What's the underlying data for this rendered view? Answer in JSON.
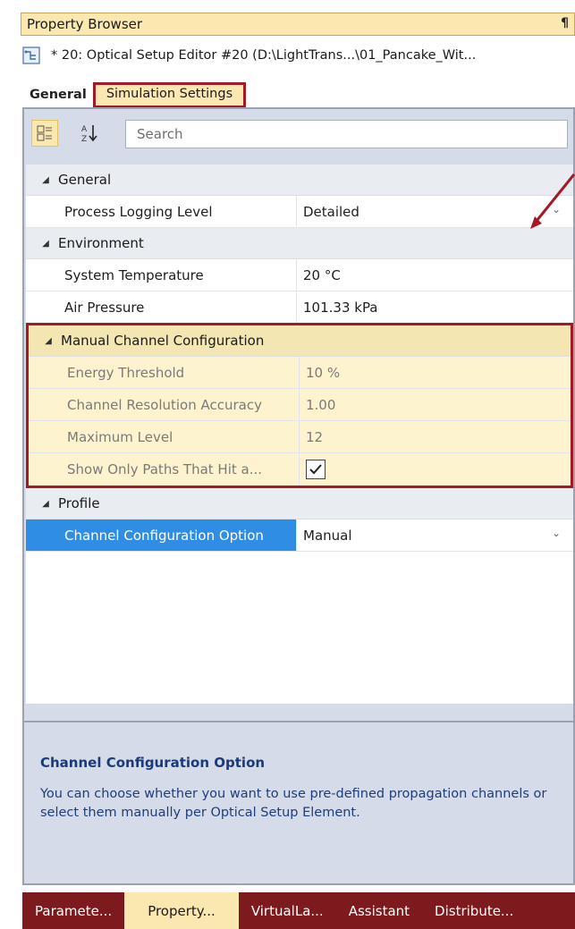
{
  "window": {
    "title": "Property Browser",
    "pin_glyph": "¶"
  },
  "document": {
    "icon": "optical-setup-icon",
    "title": "* 20: Optical Setup Editor #20 (D:\\LightTrans...\\01_Pancake_Wit..."
  },
  "tabs": {
    "general": "General",
    "simulation": "Simulation Settings"
  },
  "toolbar": {
    "categorized_icon": "categorized-view-icon",
    "alpha_icon": "sort-alphabetical-icon",
    "search_placeholder": "Search"
  },
  "categories": {
    "general": {
      "label": "General",
      "props": [
        {
          "name": "Process Logging Level",
          "value": "Detailed"
        }
      ]
    },
    "environment": {
      "label": "Environment",
      "props": [
        {
          "name": "System Temperature",
          "value": "20 °C"
        },
        {
          "name": "Air Pressure",
          "value": "101.33 kPa"
        }
      ]
    },
    "manual": {
      "label": "Manual Channel Configuration",
      "props": [
        {
          "name": "Energy Threshold",
          "value": "10 %"
        },
        {
          "name": "Channel Resolution Accuracy",
          "value": "1.00"
        },
        {
          "name": "Maximum Level",
          "value": "12"
        },
        {
          "name": "Show Only Paths That Hit a...",
          "value": true
        }
      ]
    },
    "profile": {
      "label": "Profile",
      "props": [
        {
          "name": "Channel Configuration Option",
          "value": "Manual"
        }
      ]
    }
  },
  "description": {
    "title": "Channel Configuration Option",
    "text": "You can choose whether you want to use pre-defined propagation channels or select them manually per Optical Setup Element."
  },
  "bottom_tabs": [
    "Paramete...",
    "Property...",
    "VirtualLa...",
    "Assistant",
    "Distribute..."
  ],
  "active_bottom_tab": "Property...",
  "colors": {
    "highlight_border": "#a41925",
    "selected_row": "#2f8de4",
    "tab_bar": "#7d1a1d",
    "accent_yellow": "#fbe8b0"
  }
}
